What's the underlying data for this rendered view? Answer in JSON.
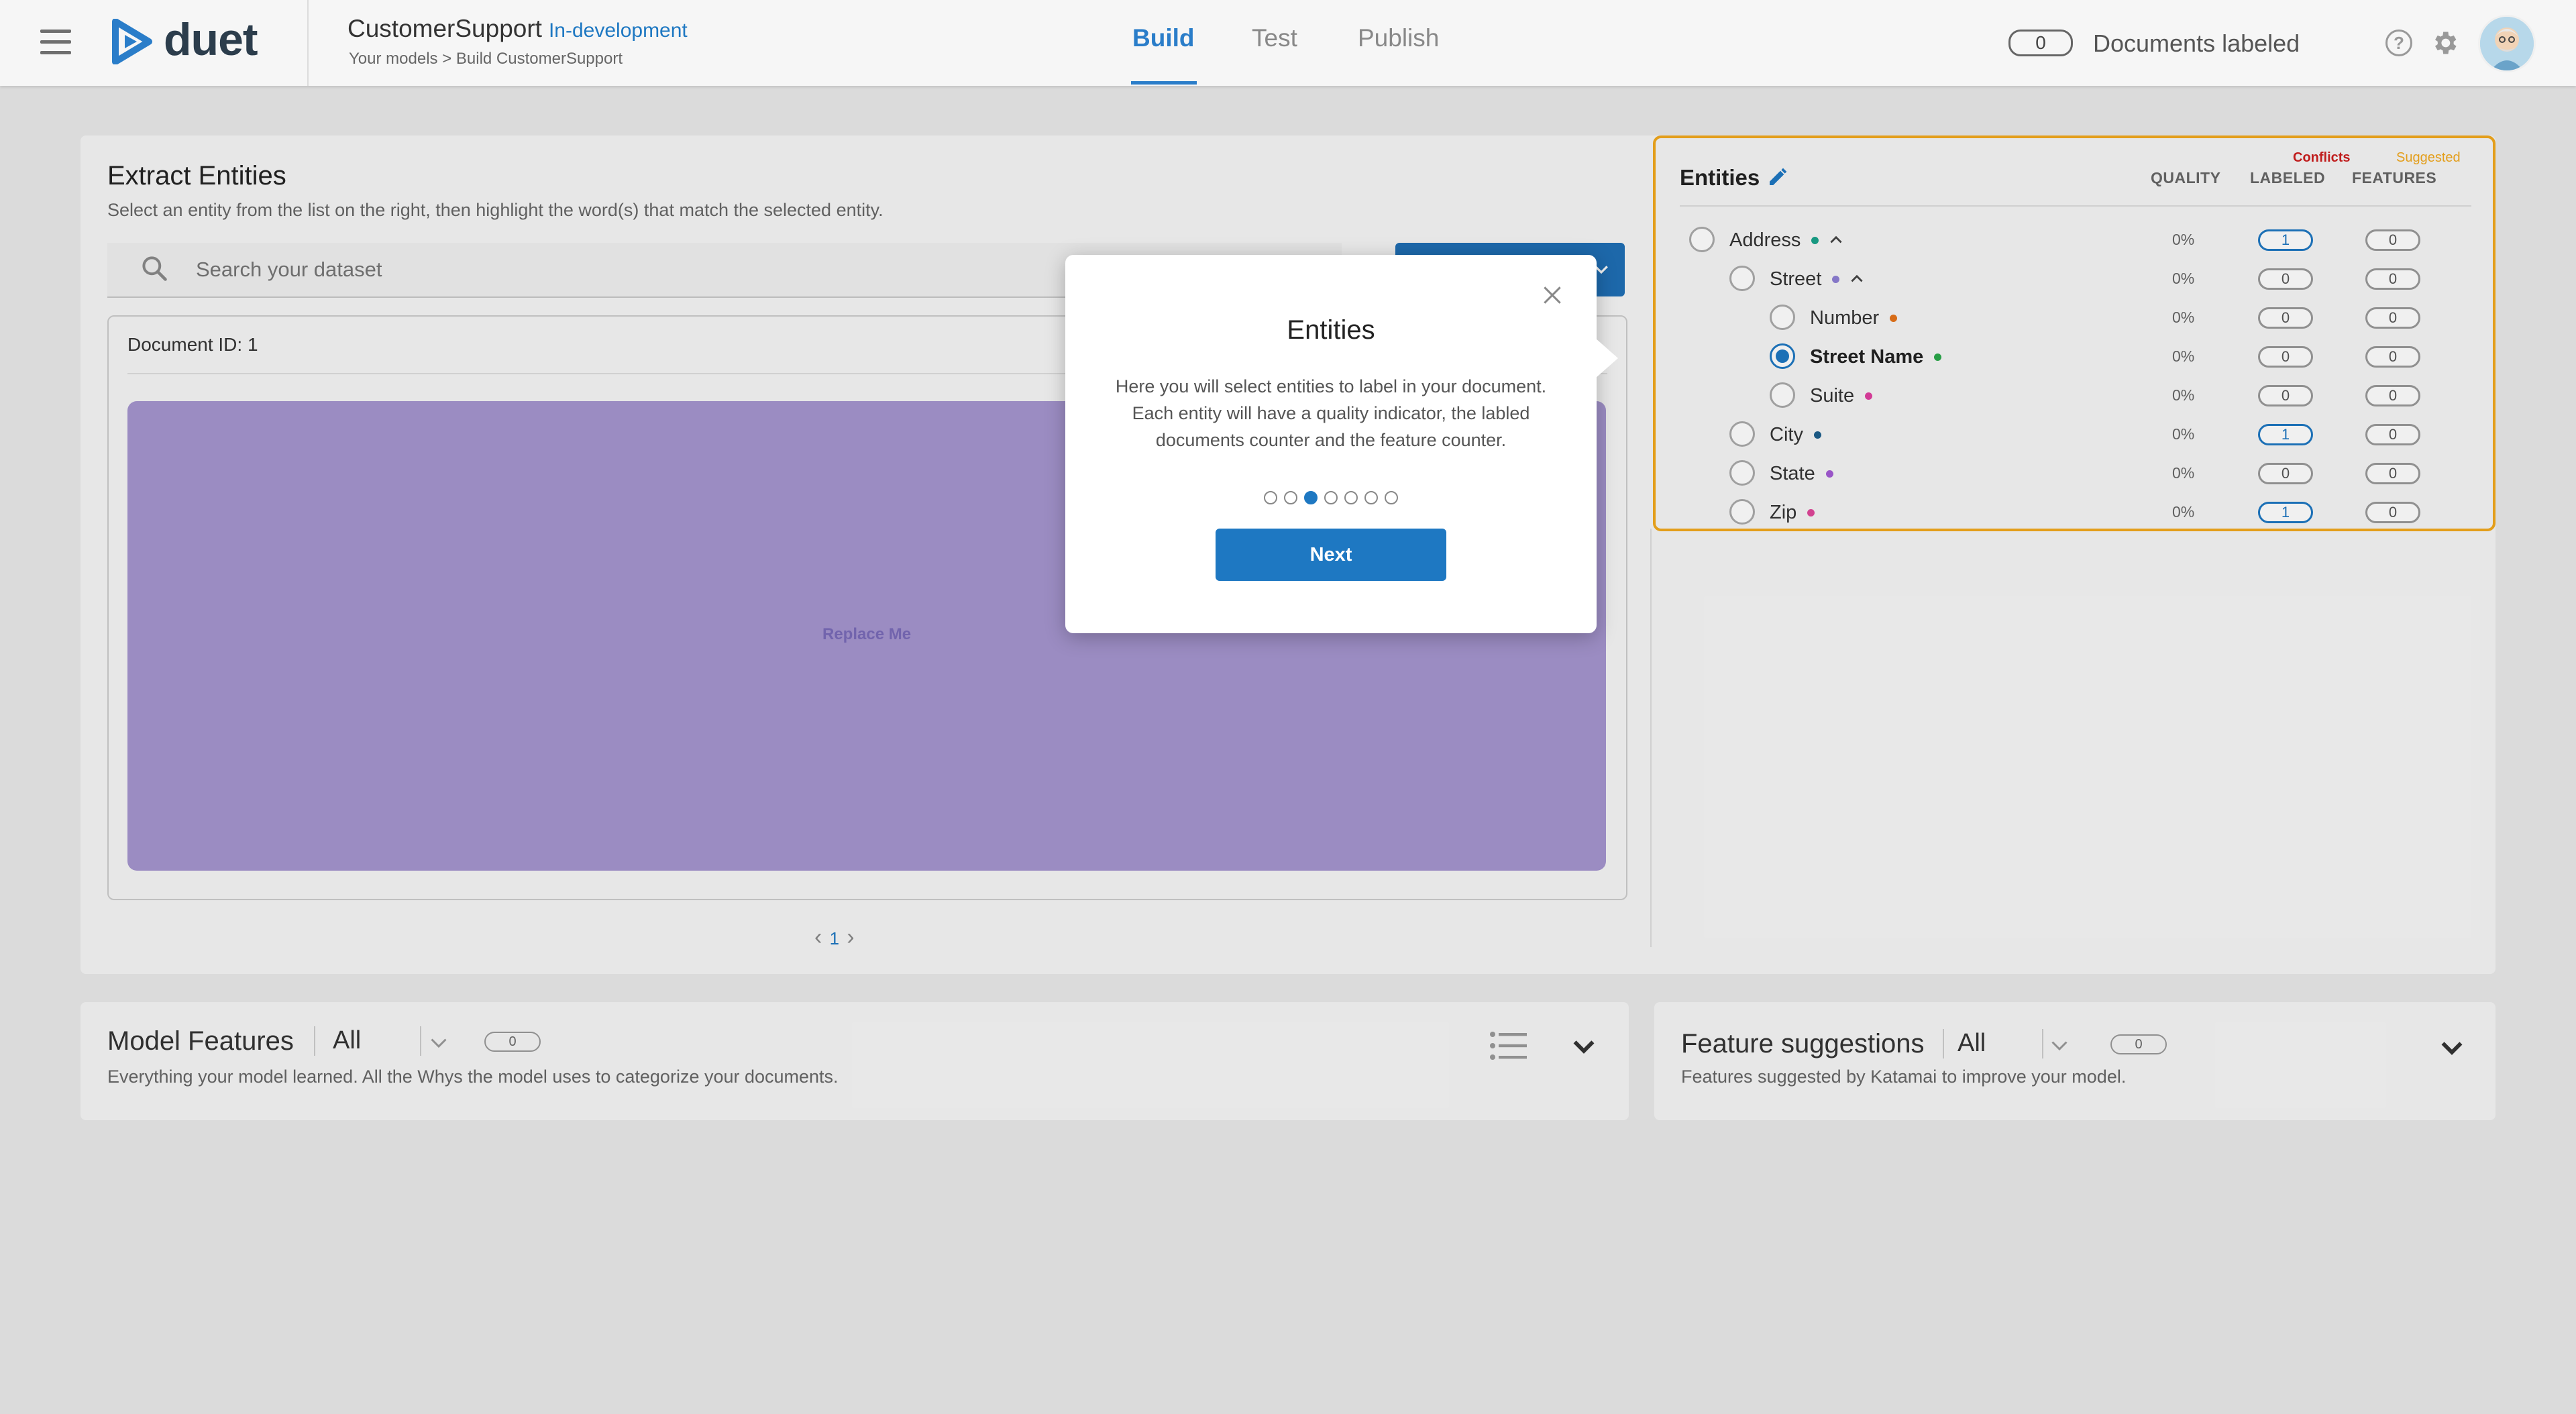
{
  "header": {
    "logo_text": "duet",
    "project_name": "CustomerSupport",
    "project_status": "In-development",
    "breadcrumb": "Your models > Build CustomerSupport",
    "tabs": [
      {
        "label": "Build",
        "active": true
      },
      {
        "label": "Test",
        "active": false
      },
      {
        "label": "Publish",
        "active": false
      }
    ],
    "documents_labeled_count": "0",
    "documents_labeled_label": "Documents labeled",
    "help_icon_glyph": "?"
  },
  "extract": {
    "title": "Extract Entities",
    "subtitle": "Select an entity from the list on the right, then highlight the word(s) that match the selected entity.",
    "search_placeholder": "Search your dataset",
    "document_id": "Document ID: 1",
    "replace_me": "Replace Me",
    "page_number": "1"
  },
  "entities": {
    "title": "Entities",
    "conflicts_label": "Conflicts",
    "suggested_label": "Suggested",
    "columns": {
      "quality": "QUALITY",
      "labeled": "LABELED",
      "features": "FEATURES"
    },
    "rows": [
      {
        "name": "Address",
        "level": 0,
        "dot": "#1aa28a",
        "expanded": true,
        "selected": false,
        "quality": "0%",
        "labeled": "1",
        "features": "0"
      },
      {
        "name": "Street",
        "level": 1,
        "dot": "#8e7fd4",
        "expanded": true,
        "selected": false,
        "quality": "0%",
        "labeled": "0",
        "features": "0"
      },
      {
        "name": "Number",
        "level": 2,
        "dot": "#e5731a",
        "expanded": false,
        "selected": false,
        "quality": "0%",
        "labeled": "0",
        "features": "0"
      },
      {
        "name": "Street Name",
        "level": 2,
        "dot": "#2aa84a",
        "expanded": false,
        "selected": true,
        "quality": "0%",
        "labeled": "0",
        "features": "0"
      },
      {
        "name": "Suite",
        "level": 2,
        "dot": "#e03fa0",
        "expanded": false,
        "selected": false,
        "quality": "0%",
        "labeled": "0",
        "features": "0"
      },
      {
        "name": "City",
        "level": 1,
        "dot": "#1d5f8c",
        "expanded": false,
        "selected": false,
        "quality": "0%",
        "labeled": "1",
        "features": "0"
      },
      {
        "name": "State",
        "level": 1,
        "dot": "#a35bd4",
        "expanded": false,
        "selected": false,
        "quality": "0%",
        "labeled": "0",
        "features": "0"
      },
      {
        "name": "Zip",
        "level": 1,
        "dot": "#e0479a",
        "expanded": false,
        "selected": false,
        "quality": "0%",
        "labeled": "1",
        "features": "0"
      }
    ]
  },
  "model_features": {
    "title": "Model Features",
    "filter": "All",
    "count": "0",
    "subtitle": "Everything your model learned. All the Whys the model uses to categorize your documents."
  },
  "feature_suggestions": {
    "title": "Feature suggestions",
    "filter": "All",
    "count": "0",
    "subtitle": "Features suggested by Katamai to improve your model."
  },
  "modal": {
    "title": "Entities",
    "body": "Here you will select entities to label in your document. Each entity will have a quality indicator, the labled documents counter and the feature counter.",
    "steps": 7,
    "active_step": 3,
    "next_label": "Next"
  },
  "colors": {
    "accent": "#1e78c2",
    "highlight_border": "#f2a81d",
    "conflicts": "#cc1f1f",
    "document_area": "#a595cf"
  }
}
